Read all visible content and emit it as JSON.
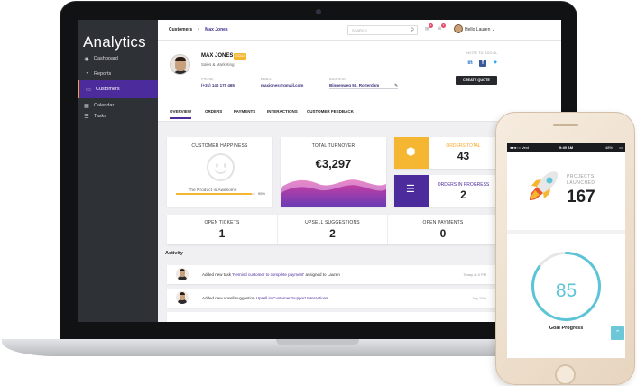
{
  "sidebar": {
    "title": "Analytics",
    "items": [
      {
        "label": "Dashboard",
        "icon": "dashboard-icon",
        "active": false
      },
      {
        "label": "Reports",
        "icon": "reports-icon",
        "active": false
      },
      {
        "label": "Customers",
        "icon": "customers-icon",
        "active": true
      },
      {
        "label": "Calendar",
        "icon": "calendar-icon",
        "active": false
      },
      {
        "label": "Tasks",
        "icon": "tasks-icon",
        "active": false
      }
    ]
  },
  "topbar": {
    "breadcrumb": [
      "Customers",
      "Max Jones"
    ],
    "search_placeholder": "SEARCH",
    "messages_count": "2",
    "notifications_count": "3",
    "user_greeting": "Hello Lauren"
  },
  "profile": {
    "name": "MAX JONES",
    "badge": "GOLD",
    "role": "Sales & Marketing",
    "phone_label": "PHONE",
    "phone": "(+31) 140 175 465",
    "email_label": "EMAIL",
    "email": "maxjones@gmail.com",
    "address_label": "ADDRESS",
    "address": "Binnenweg 50, Rotterdam",
    "social_label": "INVITE TO SOCIAL",
    "cta": "CREATE QUOTE"
  },
  "tabs": [
    "OVERVIEW",
    "ORDERS",
    "PAYMENTS",
    "INTERACTIONS",
    "CUSTOMER FEEDBACK"
  ],
  "stats": {
    "happiness_label": "CUSTOMER HAPPINESS",
    "happiness_text": "The Product is Awesome",
    "happiness_value": "95%",
    "happiness_fraction": 0.95,
    "turnover_label": "TOTAL TURNOVER",
    "turnover_value": "€3,297",
    "orders_total_label": "ORDERS TOTAL",
    "orders_total_value": "43",
    "orders_progress_label": "ORDERS IN PROGRESS",
    "orders_progress_value": "2",
    "open_tickets_label": "OPEN TICKETS",
    "open_tickets_value": "1",
    "upsell_label": "UPSELL SUGGESTIONS",
    "upsell_value": "2",
    "open_payments_label": "OPEN PAYMENTS",
    "open_payments_value": "0"
  },
  "activity": {
    "title": "Activity",
    "items": [
      {
        "pre": "Added new task ",
        "link": "'Remind customer to complete payment'",
        "post": " assigned to Lauren",
        "time": "Today at 5 PM"
      },
      {
        "pre": "Added new upsell suggestion ",
        "link": "Upsell in Customer Support Interactions",
        "post": "",
        "time": "July 27th"
      }
    ]
  },
  "phone": {
    "status_carrier": "●●●○○ Vext",
    "status_time": "9:49 AM",
    "status_battery": "48%",
    "launched_label_1": "PROJECTS",
    "launched_label_2": "LAUNCHED",
    "launched_value": "167",
    "goal_value": "85",
    "goal_fraction": 0.85,
    "goal_label": "Goal Progress"
  },
  "colors": {
    "accent_purple": "#4c2b9c",
    "accent_yellow": "#f5b731",
    "accent_teal": "#5bc4d6",
    "sidebar_bg": "#2e3136"
  }
}
